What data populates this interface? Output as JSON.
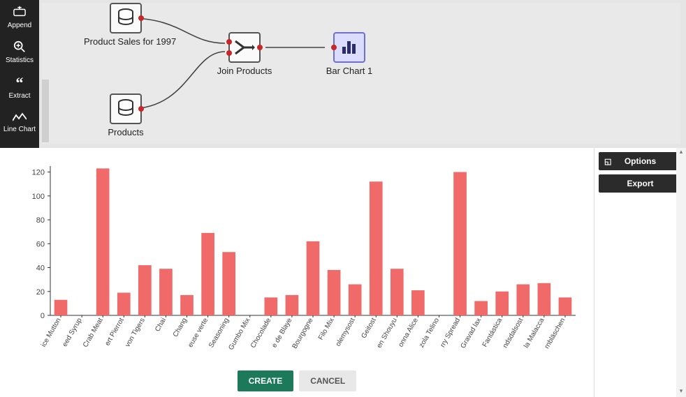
{
  "sidebar": {
    "items": [
      {
        "label": "Append",
        "icon": "+"
      },
      {
        "label": "Statistics",
        "icon": "zoom"
      },
      {
        "label": "Extract",
        "icon": "quote"
      },
      {
        "label": "Line Chart",
        "icon": "line"
      }
    ]
  },
  "canvas": {
    "nodes": {
      "sales": {
        "label": "Product Sales for 1997",
        "type": "db"
      },
      "products": {
        "label": "Products",
        "type": "db"
      },
      "join": {
        "label": "Join Products",
        "type": "join"
      },
      "chart": {
        "label": "Bar Chart 1",
        "type": "bar",
        "selected": true
      }
    }
  },
  "panel": {
    "options": "Options",
    "export": "Export"
  },
  "footer": {
    "create": "CREATE",
    "cancel": "CANCEL"
  },
  "chart_data": {
    "type": "bar",
    "ylim": [
      0,
      125
    ],
    "yticks": [
      0,
      20,
      40,
      60,
      80,
      100,
      120
    ],
    "categories": [
      "ice Mutton",
      "eed Syrup",
      "Crab Meat",
      "ert Pierrot",
      "von Tigers",
      "Chai",
      "Chang",
      "euse verte",
      "Seasoning",
      "Gumbo Mix",
      "Chocolade",
      "e de Blaye",
      "Bourgogne",
      "Filo Mix",
      "olemysost",
      "Geitost",
      "en Shouyu",
      "onna Alice",
      "zola Telino",
      "rry Spread",
      "Gravad lax",
      "Fantástica",
      "ndsdalsost",
      "la Malacca",
      "rnbläschen"
    ],
    "values": [
      13,
      0,
      123,
      19,
      42,
      39,
      17,
      69,
      53,
      0,
      15,
      17,
      62,
      38,
      26,
      112,
      39,
      21,
      0,
      120,
      12,
      20,
      26,
      27,
      15
    ]
  }
}
